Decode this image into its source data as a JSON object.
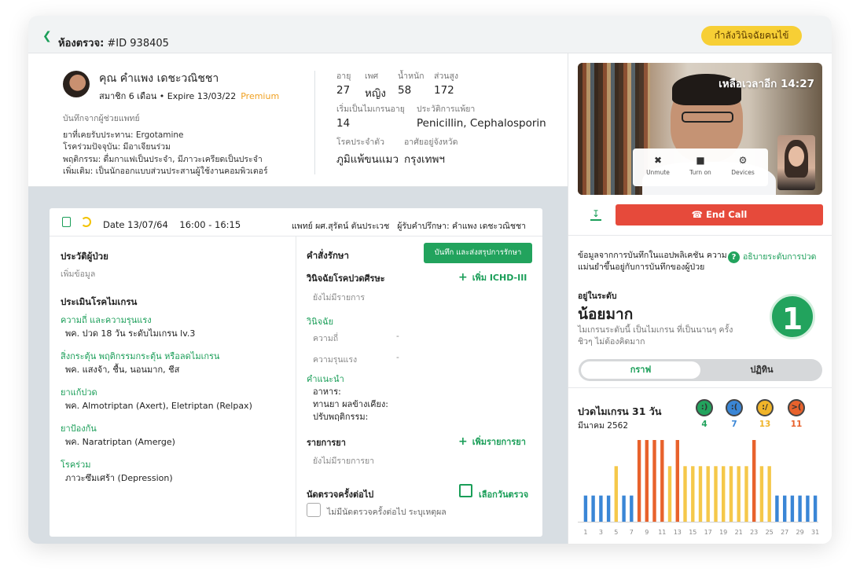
{
  "header": {
    "back_icon": "chevron-left-icon",
    "room_label": "ห้องตรวจ:",
    "room_id": "#ID 938405",
    "status": "กำลังวินิจฉัยคนไข้",
    "accent": "#1a9e58",
    "status_color": "#f7cf35"
  },
  "patient": {
    "name": "คุณ คำแพง เดชะวณิชชา",
    "membership": "สมาชิก 6 เดือน • Expire 13/03/22",
    "premium": "Premium",
    "notes_title": "บันทึกจากผู้ช่วยแพทย์",
    "notes": [
      "ยาที่เคยรับประทาน: Ergotamine",
      "โรคร่วมปัจจุบัน: มีอาเจียนร่วม",
      "พฤติกรรม: ดื่มกาแฟเป็นประจำ, มีภาวะเครียดเป็นประจำ",
      "เพิ่มเติม: เป็นนักออกแบบส่วนประสานผู้ใช้งานคอมพิวเตอร์"
    ],
    "age_label": "อายุ",
    "age": "27",
    "sex_label": "เพศ",
    "sex": "หญิง",
    "weight_label": "น้ำหนัก",
    "weight": "58",
    "height_label": "ส่วนสูง",
    "height": "172",
    "onset_label": "เริ่มเป็นไมเกรนอายุ",
    "onset": "14",
    "allergy_label": "ประวัติการแพ้ยา",
    "allergy": "Penicillin, Cephalosporin",
    "disease_label": "โรคประจำตัว",
    "disease": "ภูมิแพ้ขนแมว",
    "province_label": "อาศัยอยู่จังหวัด",
    "province": "กรุงเทพฯ"
  },
  "session": {
    "date": "Date 13/07/64",
    "time": "16:00 - 16:15",
    "doctor": "แพทย์ ผศ.สุรัตน์ ตันประเวช",
    "consultee": "ผู้รับคำปรึกษา: คำแพง เดชะวณิชชา"
  },
  "history": {
    "title": "ประวัติผู้ป่วย",
    "add": "เพิ่มข้อมูล",
    "eval_title": "ประเมินโรคไมเกรน",
    "items": [
      {
        "label": "ความถี่ และความรุนแรง",
        "value": "พค. ปวด 18 วัน ระดับไมเกรน lv.3"
      },
      {
        "label": "สิ่งกระตุ้น พฤติกรรมกระตุ้น หรือลดไมเกรน",
        "value": "พค. แสงจ้า, ชื้น, นอนมาก, ชีส"
      },
      {
        "label": "ยาแก้ปวด",
        "value": "พค. Almotriptan (Axert), Eletriptan (Relpax)"
      },
      {
        "label": "ยาป้องกัน",
        "value": "พค. Naratriptan (Amerge)"
      },
      {
        "label": "โรคร่วม",
        "value": "ภาวะซึมเศร้า (Depression)"
      }
    ]
  },
  "orders": {
    "title": "คำสั่งรักษา",
    "save_button": "บันทึก และส่งสรุปการรักษา",
    "dx_title": "วินิจฉัยโรคปวดศีรษะ",
    "add_icd": "เพิ่ม ICHD-III",
    "no_items": "ยังไม่มีรายการ",
    "dx_label": "วินิจฉัย",
    "freq_label": "ความถี่",
    "freq_value": "-",
    "severity_label": "ความรุนแรง",
    "severity_value": "-",
    "advice_label": "คำแนะนำ",
    "advice_lines": [
      "อาหาร:",
      "ทานยา ผลข้างเคียง:",
      "ปรับพฤติกรรม:"
    ],
    "med_title": "รายการยา",
    "add_med": "เพิ่มรายการยา",
    "no_med": "ยังไม่มีรายการยา",
    "next_title": "นัดตรวจครั้งต่อไป",
    "pick_date": "เลือกวันตรวจ",
    "no_next": "ไม่มีนัดตรวจครั้งต่อไป ระบุเหตุผล"
  },
  "call": {
    "time_left": "เหลือเวลาอีก 14:27",
    "unmute": "Unmute",
    "turn_on": "Turn on",
    "devices": "Devices",
    "end_call": "End Call",
    "end_color": "#e64a3b"
  },
  "assessment": {
    "info": "ข้อมูลจากการบันทึกในแอปพลิเคชัน ความแม่นยำขึ้นอยู่กับการบันทึกของผู้ป่วย",
    "help": "อธิบายระดับการปวด",
    "level_label": "อยู่ในระดับ",
    "level_name": "น้อยมาก",
    "level_desc": "ไมเกรนระดับนี้ เป็นไมเกรน ที่เป็นนานๆ ครั้ง ชิวๆ ไม่ต้องคิดมาก",
    "level_number": "1",
    "tab_graph": "กราฟ",
    "tab_calendar": "ปฏิทิน"
  },
  "summary": {
    "title": "ปวดไมเกรน 31 วัน",
    "month": "มีนาคม 2562",
    "faces": [
      {
        "count": "4",
        "color": "#22a35d",
        "icon": "happy-face-icon"
      },
      {
        "count": "7",
        "color": "#3a86d6",
        "icon": "sad-face-icon"
      },
      {
        "count": "13",
        "color": "#f0b429",
        "icon": "worried-face-icon"
      },
      {
        "count": "11",
        "color": "#e8622c",
        "icon": "angry-face-icon"
      }
    ]
  },
  "chart_data": {
    "type": "bar",
    "title": "ปวดไมเกรน 31 วัน",
    "subtitle": "มีนาคม 2562",
    "x": [
      1,
      2,
      3,
      4,
      5,
      6,
      7,
      8,
      9,
      10,
      11,
      12,
      13,
      14,
      15,
      16,
      17,
      18,
      19,
      20,
      21,
      22,
      23,
      24,
      25,
      26,
      27,
      28,
      29,
      30,
      31
    ],
    "x_tick_labels": [
      "1",
      "3",
      "5",
      "7",
      "9",
      "11",
      "13",
      "15",
      "17",
      "19",
      "21",
      "23",
      "25",
      "27",
      "29",
      "31"
    ],
    "values": [
      1,
      1,
      1,
      1,
      2,
      1,
      1,
      4,
      4,
      4,
      4,
      3,
      4,
      2,
      3,
      3,
      3,
      3,
      3,
      3,
      3,
      3,
      4,
      3,
      3,
      1,
      1,
      1,
      1,
      1,
      1
    ],
    "level_colors": {
      "1": "#3a86d6",
      "2": "#f5c84a",
      "3": "#f5c84a",
      "4": "#e8622c"
    },
    "ylim": [
      0,
      4
    ],
    "grid": false
  }
}
